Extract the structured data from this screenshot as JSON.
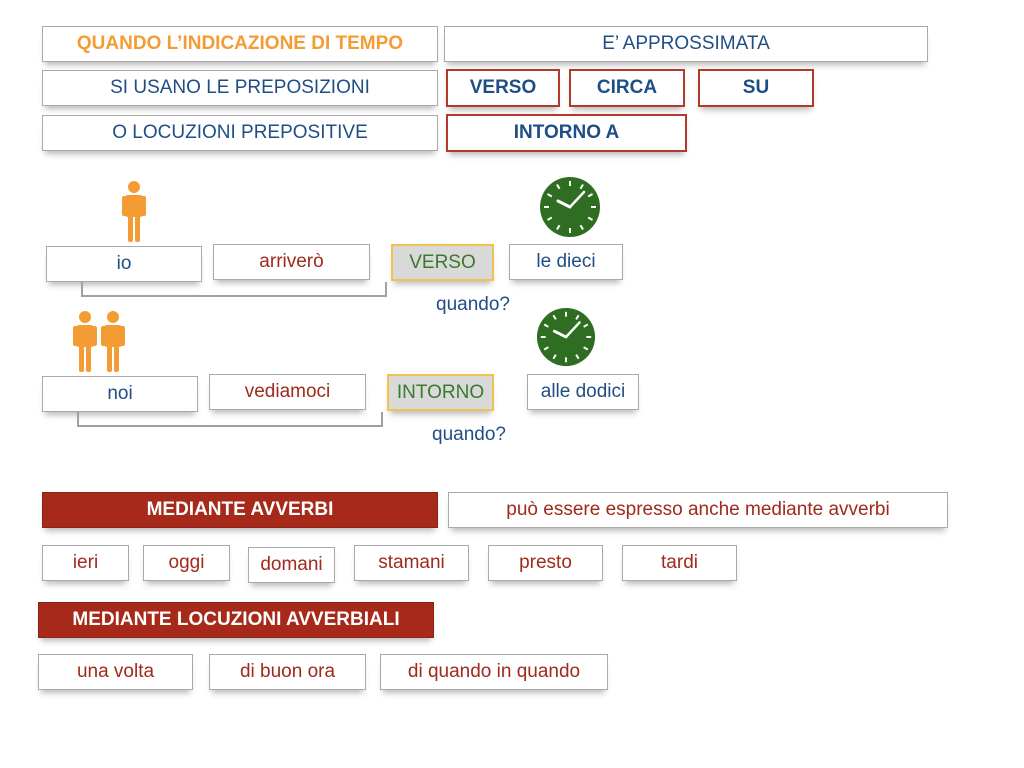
{
  "header": {
    "title": "QUANDO L’INDICAZIONE DI TEMPO",
    "title_continuation": "E’ APPROSSIMATA",
    "row2_label": "SI USANO LE PREPOSIZIONI",
    "row3_label": "O LOCUZIONI PREPOSITIVE",
    "prepositions": [
      "VERSO",
      "CIRCA",
      "SU"
    ],
    "locution": "INTORNO A"
  },
  "example1": {
    "subject": "io",
    "verb": "arriverò",
    "preposition": "VERSO",
    "time": "le dieci",
    "question": "quando?",
    "person_icon": "single-person-icon",
    "clock_icon": "clock-icon"
  },
  "example2": {
    "subject": "noi",
    "verb": "vediamoci",
    "preposition": "INTORNO",
    "time": "alle dodici",
    "question": "quando?",
    "person_icon": "two-persons-icon",
    "clock_icon": "clock-icon"
  },
  "adverbs": {
    "heading": "MEDIANTE AVVERBI",
    "description": "può essere espresso anche mediante avverbi",
    "items": [
      "ieri",
      "oggi",
      "domani",
      "stamani",
      "presto",
      "tardi"
    ]
  },
  "locutions": {
    "heading": "MEDIANTE LOCUZIONI AVVERBIALI",
    "items": [
      "una volta",
      "di buon ora",
      "di quando in quando"
    ]
  },
  "colors": {
    "title_orange": "#f39c34",
    "text_blue": "#1f4e86",
    "text_red": "#a02a1c",
    "text_green": "#3a7a2a",
    "fill_red": "#a6291a",
    "highlight_border": "#f2c24e",
    "clock_green": "#2f6e22"
  }
}
